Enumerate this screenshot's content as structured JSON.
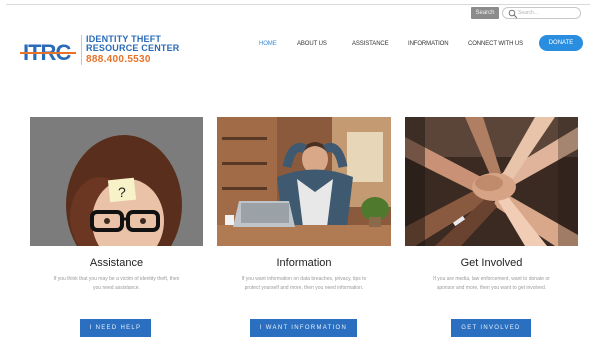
{
  "topbar": {
    "search_button_label": "Search",
    "search_placeholder": "Search..."
  },
  "logo": {
    "mark": "ITRC",
    "line1": "IDENTITY THEFT",
    "line2": "RESOURCE CENTER",
    "phone": "888.400.5530"
  },
  "nav": {
    "items": [
      {
        "label": "HOME",
        "active": true
      },
      {
        "label": "ABOUT US",
        "active": false
      },
      {
        "label": "ASSISTANCE",
        "active": false
      },
      {
        "label": "INFORMATION",
        "active": false
      },
      {
        "label": "CONNECT WITH US",
        "active": false
      }
    ],
    "donate_label": "DONATE"
  },
  "cards": [
    {
      "title": "Assistance",
      "description_line1": "If you think that you may be a victim of identity theft, then",
      "description_line2": "you need assistance.",
      "button_label": "I NEED HELP",
      "sticky_note": "?"
    },
    {
      "title": "Information",
      "description_line1": "If you want information on data breaches, privacy, tips to",
      "description_line2": "protect yourself and more, then you need information.",
      "button_label": "I WANT INFORMATION"
    },
    {
      "title": "Get Involved",
      "description_line1": "If you are media, law enforcement, want to donate or",
      "description_line2": "sponsor and more, then you want to get involved.",
      "button_label": "GET INVOLVED"
    }
  ],
  "colors": {
    "brand_blue": "#2a6bb8",
    "brand_orange": "#e8722a",
    "button_blue": "#2a6fc0",
    "donate_blue": "#2a8ee0",
    "nav_active": "#3a89d4"
  }
}
